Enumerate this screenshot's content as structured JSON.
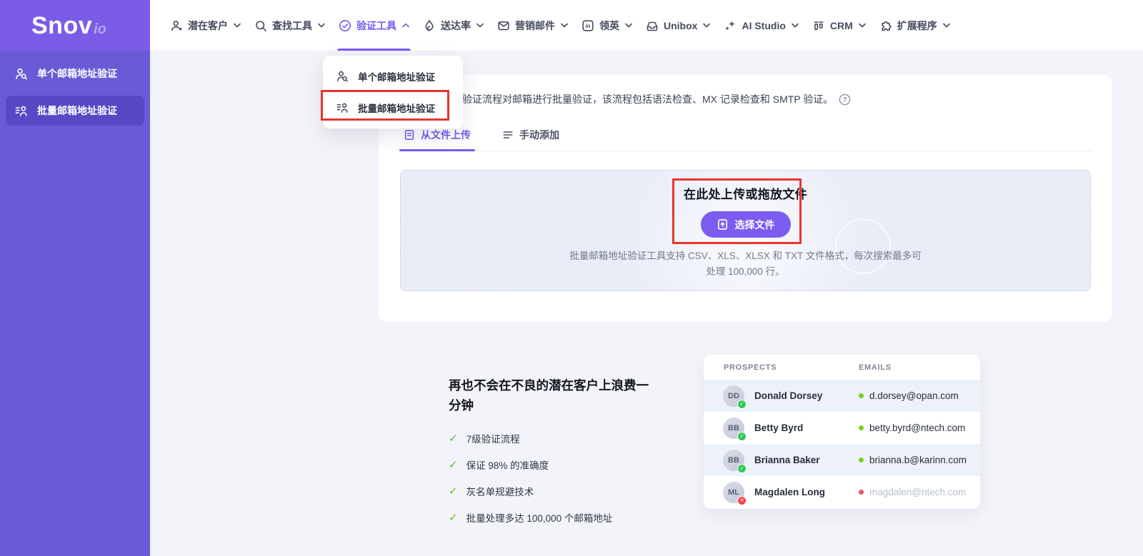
{
  "brand": {
    "name": "Snov",
    "suffix": "io"
  },
  "colors": {
    "accent": "#7a5af5",
    "sidebar": "#695bd5",
    "sidebar_logo": "#7b5ce6",
    "annotation_red": "#e8352d",
    "valid_green": "#76d21e",
    "invalid_red": "#f4515c"
  },
  "sidebar": {
    "items": [
      {
        "icon": "person-search-icon",
        "label": "单个邮箱地址验证",
        "active": false
      },
      {
        "icon": "list-person-icon",
        "label": "批量邮箱地址验证",
        "active": true
      }
    ]
  },
  "nav": {
    "items": [
      {
        "icon": "users-icon",
        "label": "潜在客户",
        "chevron": "down",
        "active": false
      },
      {
        "icon": "search-icon",
        "label": "查找工具",
        "chevron": "down",
        "active": false
      },
      {
        "icon": "check-circle-icon",
        "label": "验证工具",
        "chevron": "up",
        "active": true
      },
      {
        "icon": "flame-icon",
        "label": "送达率",
        "chevron": "down",
        "active": false
      },
      {
        "icon": "mail-icon",
        "label": "营销邮件",
        "chevron": "down",
        "active": false
      },
      {
        "icon": "linkedin-icon",
        "label": "领英",
        "chevron": "down",
        "active": false
      },
      {
        "icon": "inbox-icon",
        "label": "Unibox",
        "chevron": "down",
        "active": false
      },
      {
        "icon": "sparkles-icon",
        "label": "AI Studio",
        "chevron": "down",
        "active": false
      },
      {
        "icon": "crm-icon",
        "label": "CRM",
        "chevron": "down",
        "active": false
      },
      {
        "icon": "puzzle-icon",
        "label": "扩展程序",
        "chevron": "down",
        "active": false
      }
    ]
  },
  "dropdown": {
    "items": [
      {
        "icon": "person-search-icon",
        "label": "单个邮箱地址验证",
        "annotated": false
      },
      {
        "icon": "list-person-icon",
        "label": "批量邮箱地址验证",
        "annotated": true
      }
    ]
  },
  "main": {
    "intro_text": "验证流程对邮箱进行批量验证，该流程包括语法检查、MX 记录检查和 SMTP 验证。",
    "help_icon": "question-circle-icon",
    "tabs": [
      {
        "icon": "file-upload-icon",
        "label": "从文件上传",
        "active": true
      },
      {
        "icon": "manual-add-icon",
        "label": "手动添加",
        "active": false
      }
    ],
    "upload": {
      "title": "在此处上传或拖放文件",
      "button_label": "选择文件",
      "desc_line1": "批量邮箱地址验证工具支持 CSV、XLS、XLSX 和 TXT 文件格式，每次搜索最多可",
      "desc_line2": "处理 100,000 行。"
    }
  },
  "promo": {
    "heading": "再也不会在不良的潜在客户上浪费一分钟",
    "check_glyph": "✓",
    "bullets": [
      {
        "text": "7级验证流程"
      },
      {
        "text": "保证 98% 的准确度"
      },
      {
        "text": "灰名单规避技术"
      },
      {
        "text": "批量处理多达 100,000 个邮箱地址"
      }
    ]
  },
  "prospects": {
    "headers": {
      "col1": "PROSPECTS",
      "col2": "EMAILS"
    },
    "rows": [
      {
        "initials": "DD",
        "name": "Donald Dorsey",
        "email": "d.dorsey@opan.com",
        "status": "valid",
        "badge_glyph": "✓"
      },
      {
        "initials": "BB",
        "name": "Betty Byrd",
        "email": "betty.byrd@ntech.com",
        "status": "valid",
        "badge_glyph": "✓"
      },
      {
        "initials": "BB",
        "name": "Brianna Baker",
        "email": "brianna.b@karinn.com",
        "status": "valid",
        "badge_glyph": "✓"
      },
      {
        "initials": "ML",
        "name": "Magdalen Long",
        "email": "magdalen@ntech.com",
        "status": "invalid",
        "badge_glyph": "✕"
      }
    ]
  }
}
